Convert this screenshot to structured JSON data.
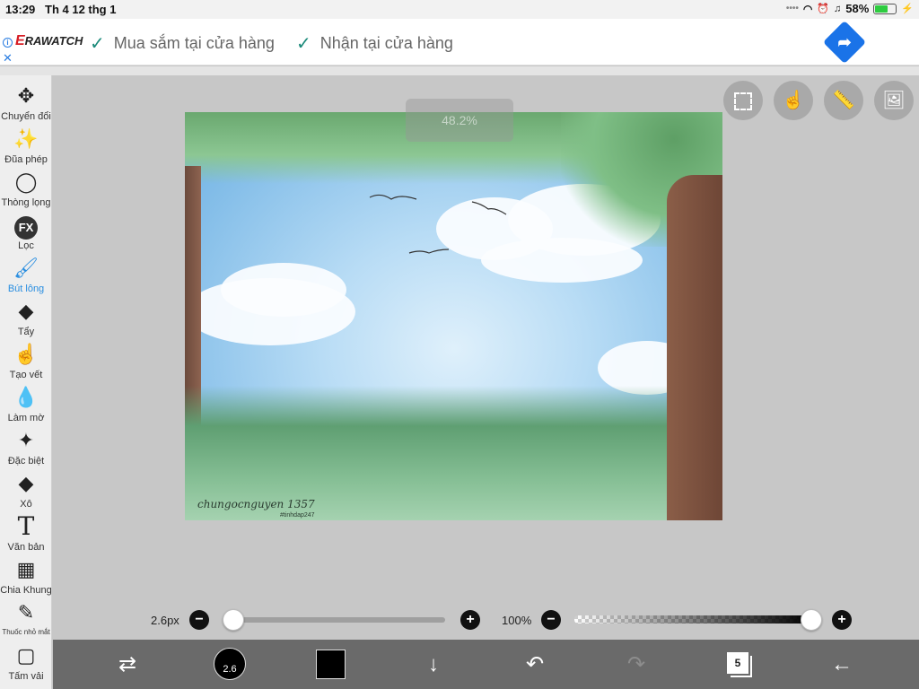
{
  "status": {
    "time": "13:29",
    "date": "Th 4 12 thg 1",
    "battery": "58%",
    "battery_level": 0.58
  },
  "ad": {
    "brand": "RAWATCH",
    "brand_initial": "E",
    "feature1": "Mua sắm tại cửa hàng",
    "feature2": "Nhận tại cửa hàng"
  },
  "tools": [
    {
      "label": "Chuyển đổi",
      "icon": "move-icon"
    },
    {
      "label": "Đũa phép",
      "icon": "magic-wand-icon"
    },
    {
      "label": "Thòng lọng",
      "icon": "lasso-icon"
    },
    {
      "label": "Lọc",
      "icon": "fx-icon",
      "badge": "FX"
    },
    {
      "label": "Bút lông",
      "icon": "brush-icon"
    },
    {
      "label": "Tẩy",
      "icon": "eraser-icon"
    },
    {
      "label": "Tạo vết",
      "icon": "smudge-icon"
    },
    {
      "label": "Làm mờ",
      "icon": "blur-drop-icon"
    },
    {
      "label": "Đặc biệt",
      "icon": "sparkle-icon"
    },
    {
      "label": "Xô",
      "icon": "bucket-icon"
    },
    {
      "label": "Văn bản",
      "icon": "text-icon",
      "glyph": "T"
    },
    {
      "label": "Chia Khung",
      "icon": "frame-divider-icon"
    },
    {
      "label": "Thuốc nhỏ mắt",
      "icon": "eyedropper-icon"
    },
    {
      "label": "Tấm vải",
      "icon": "canvas-icon"
    }
  ],
  "active_tool": "Bút lông",
  "canvas": {
    "signature": "chungocnguyen 1357",
    "signature_sub": "#tinhdap247",
    "zoom_overlay": "48.2%"
  },
  "brush": {
    "size_label": "2.6px",
    "size_badge": "2.6",
    "size_fraction": 0.0,
    "opacity_label": "100%",
    "opacity_fraction": 1.0,
    "color": "#000000"
  },
  "layers_count": "5",
  "colors": {
    "accent": "#2a8ee0",
    "bottom_bar": "#6a6a6a",
    "ad_arrow": "#1a73e8"
  }
}
